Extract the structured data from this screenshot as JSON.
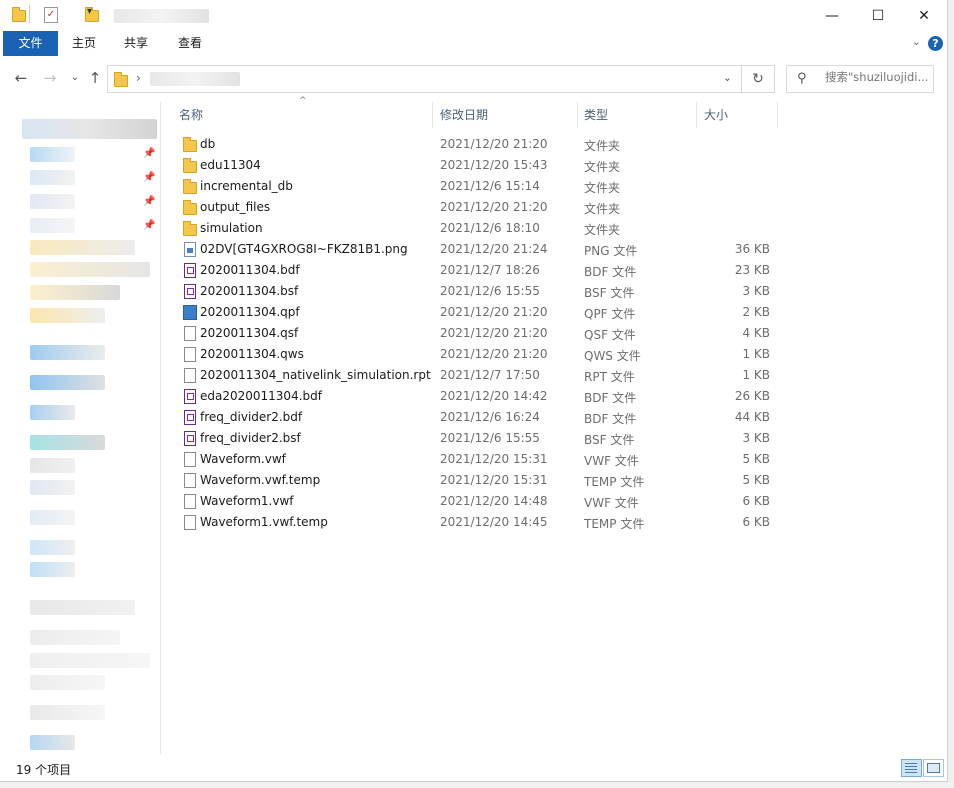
{
  "window": {
    "buttons": {
      "minimize": "—",
      "maximize": "☐",
      "close": "✕"
    }
  },
  "ribbon": {
    "tabs": [
      {
        "label": "文件"
      },
      {
        "label": "主页"
      },
      {
        "label": "共享"
      },
      {
        "label": "查看"
      }
    ]
  },
  "nav": {
    "search_placeholder": "搜索\"shuziluojidi...",
    "refresh_icon": "refresh-icon"
  },
  "columns": {
    "name": "名称",
    "date": "修改日期",
    "type": "类型",
    "size": "大小"
  },
  "files": [
    {
      "name": "db",
      "date": "2021/12/20 21:20",
      "type": "文件夹",
      "size": "",
      "icon": "folder"
    },
    {
      "name": "edu11304",
      "date": "2021/12/20 15:43",
      "type": "文件夹",
      "size": "",
      "icon": "folder"
    },
    {
      "name": "incremental_db",
      "date": "2021/12/6 15:14",
      "type": "文件夹",
      "size": "",
      "icon": "folder"
    },
    {
      "name": "output_files",
      "date": "2021/12/20 21:20",
      "type": "文件夹",
      "size": "",
      "icon": "folder"
    },
    {
      "name": "simulation",
      "date": "2021/12/6 18:10",
      "type": "文件夹",
      "size": "",
      "icon": "folder"
    },
    {
      "name": "02DV[GT4GXROG8I~FKZ81B1.png",
      "date": "2021/12/20 21:24",
      "type": "PNG 文件",
      "size": "36 KB",
      "icon": "png"
    },
    {
      "name": "2020011304.bdf",
      "date": "2021/12/7 18:26",
      "type": "BDF 文件",
      "size": "23 KB",
      "icon": "bdf"
    },
    {
      "name": "2020011304.bsf",
      "date": "2021/12/6 15:55",
      "type": "BSF 文件",
      "size": "3 KB",
      "icon": "bdf"
    },
    {
      "name": "2020011304.qpf",
      "date": "2021/12/20 21:20",
      "type": "QPF 文件",
      "size": "2 KB",
      "icon": "qpf"
    },
    {
      "name": "2020011304.qsf",
      "date": "2021/12/20 21:20",
      "type": "QSF 文件",
      "size": "4 KB",
      "icon": "doc"
    },
    {
      "name": "2020011304.qws",
      "date": "2021/12/20 21:20",
      "type": "QWS 文件",
      "size": "1 KB",
      "icon": "doc"
    },
    {
      "name": "2020011304_nativelink_simulation.rpt",
      "date": "2021/12/7 17:50",
      "type": "RPT 文件",
      "size": "1 KB",
      "icon": "doc"
    },
    {
      "name": "eda2020011304.bdf",
      "date": "2021/12/20 14:42",
      "type": "BDF 文件",
      "size": "26 KB",
      "icon": "bdf"
    },
    {
      "name": "freq_divider2.bdf",
      "date": "2021/12/6 16:24",
      "type": "BDF 文件",
      "size": "44 KB",
      "icon": "bdf"
    },
    {
      "name": "freq_divider2.bsf",
      "date": "2021/12/6 15:55",
      "type": "BSF 文件",
      "size": "3 KB",
      "icon": "bdf"
    },
    {
      "name": "Waveform.vwf",
      "date": "2021/12/20 15:31",
      "type": "VWF 文件",
      "size": "5 KB",
      "icon": "doc"
    },
    {
      "name": "Waveform.vwf.temp",
      "date": "2021/12/20 15:31",
      "type": "TEMP 文件",
      "size": "5 KB",
      "icon": "doc"
    },
    {
      "name": "Waveform1.vwf",
      "date": "2021/12/20 14:48",
      "type": "VWF 文件",
      "size": "6 KB",
      "icon": "doc"
    },
    {
      "name": "Waveform1.vwf.temp",
      "date": "2021/12/20 14:45",
      "type": "TEMP 文件",
      "size": "6 KB",
      "icon": "doc"
    }
  ],
  "status": {
    "count": "19 个项目"
  },
  "colors": {
    "accent": "#1a63b3",
    "folder": "#f4c74a"
  }
}
